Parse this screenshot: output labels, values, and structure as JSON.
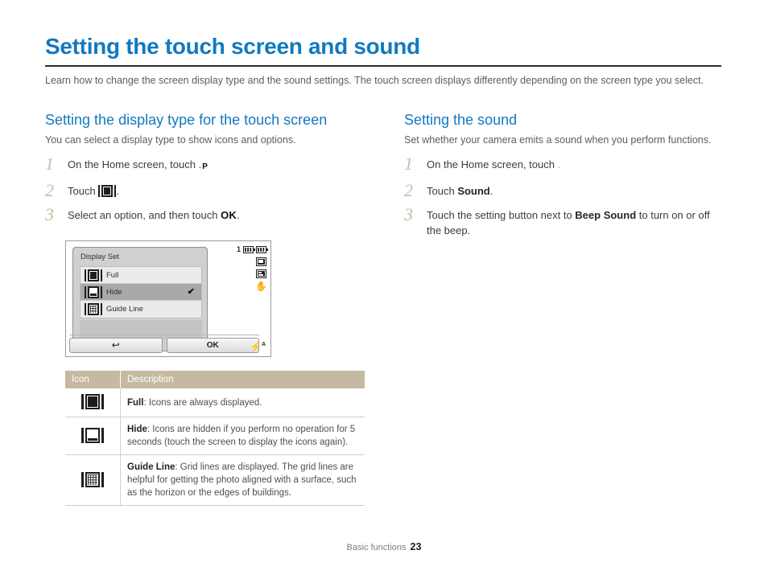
{
  "header": {
    "title": "Setting the touch screen and sound",
    "intro": "Learn how to change the screen display type and the sound settings. The touch screen displays differently depending on the screen type you select."
  },
  "left_column": {
    "section_title": "Setting the display type for the touch screen",
    "section_intro": "You can select a display type to show icons and options.",
    "steps": [
      {
        "number": "1",
        "text_before": "On the Home screen, touch ",
        "icon": "p-mode-icon",
        "text_after": "."
      },
      {
        "number": "2",
        "text_before": "Touch ",
        "icon": "display-set-icon",
        "text_after": "."
      },
      {
        "number": "3",
        "text_before": "Select an option, and then touch ",
        "emphasis": "OK",
        "text_after": "."
      }
    ]
  },
  "right_column": {
    "section_title": "Setting the sound",
    "section_intro": "Set whether your camera emits a sound when you perform functions.",
    "steps": [
      {
        "number": "1",
        "text_before": "On the Home screen, touch ",
        "icon": "settings-gear-icon",
        "text_after": "."
      },
      {
        "number": "2",
        "text_before": "Touch ",
        "emphasis": "Sound",
        "text_after": "."
      },
      {
        "number": "3",
        "text_before": "Touch the setting button next to ",
        "emphasis": "Beep Sound",
        "text_after": " to turn on or off the beep."
      }
    ]
  },
  "camera_screen": {
    "panel_title": "Display Set",
    "options": [
      {
        "label": "Full",
        "icon": "display-full-icon",
        "selected": false,
        "check": ""
      },
      {
        "label": "Hide",
        "icon": "display-hide-icon",
        "selected": true,
        "check": "✔"
      },
      {
        "label": "Guide Line",
        "icon": "display-grid-icon",
        "selected": false,
        "check": ""
      }
    ],
    "buttons": {
      "back_label": "↩",
      "ok_label": "OK"
    },
    "status_icons": {
      "burst_count": "1",
      "battery_left": "battery-icon",
      "battery_right": "battery-full-icon",
      "resolution": "image-size-icon",
      "quality": "image-quality-icon",
      "stabilizer": "ois-hand-icon",
      "flash": "⚡",
      "flash_mode": "A"
    }
  },
  "table": {
    "columns": [
      "Icon",
      "Description"
    ],
    "rows": [
      {
        "icon": "display-full-icon",
        "term": "Full",
        "description": ": Icons are always displayed."
      },
      {
        "icon": "display-hide-icon",
        "term": "Hide",
        "description": ": Icons are hidden if you perform no operation for 5 seconds (touch the screen to display the icons again)."
      },
      {
        "icon": "display-grid-icon",
        "term": "Guide Line",
        "description": ": Grid lines are displayed. The grid lines are helpful for getting the photo aligned with a surface, such as the horizon or the edges of buildings."
      }
    ]
  },
  "footer": {
    "chapter": "Basic functions",
    "page_number": "23"
  },
  "colors": {
    "heading_blue": "#1179c0",
    "table_header_tan": "#c5b9a1",
    "step_number_tan": "#c8bda6",
    "icon_badge_blue": "#1f4e9c"
  }
}
